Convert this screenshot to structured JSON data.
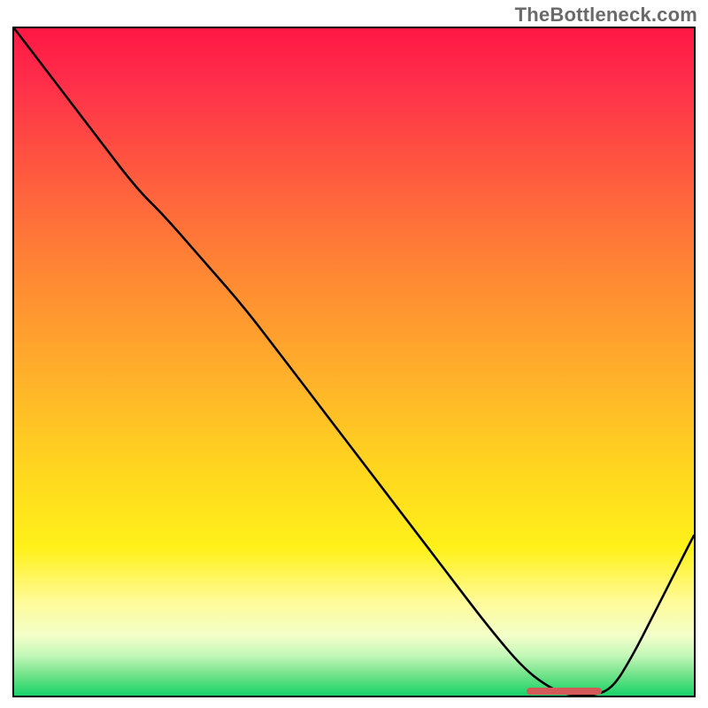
{
  "watermark": "TheBottleneck.com",
  "chart_data": {
    "type": "line",
    "title": "",
    "xlabel": "",
    "ylabel": "",
    "xlim": [
      0,
      100
    ],
    "ylim": [
      0,
      100
    ],
    "grid": false,
    "series": [
      {
        "name": "bottleneck-curve",
        "x": [
          0,
          6,
          12,
          18,
          22,
          28,
          34,
          40,
          46,
          52,
          58,
          64,
          70,
          75,
          79,
          82,
          85,
          88,
          91,
          94,
          97,
          100
        ],
        "y": [
          100,
          92,
          84,
          76,
          72,
          65,
          58,
          50,
          42,
          34,
          26,
          18,
          10,
          4,
          1,
          0,
          0,
          1,
          6,
          12,
          18,
          24
        ]
      }
    ],
    "highlight_band": {
      "x_start": 75,
      "x_end": 86,
      "y": 1.2
    },
    "background_gradient": {
      "stops": [
        {
          "pos": 0.0,
          "color": "#ff1744"
        },
        {
          "pos": 0.5,
          "color": "#ffc107"
        },
        {
          "pos": 0.8,
          "color": "#fff11a"
        },
        {
          "pos": 0.95,
          "color": "#c3f7b8"
        },
        {
          "pos": 1.0,
          "color": "#17d36a"
        }
      ]
    }
  }
}
